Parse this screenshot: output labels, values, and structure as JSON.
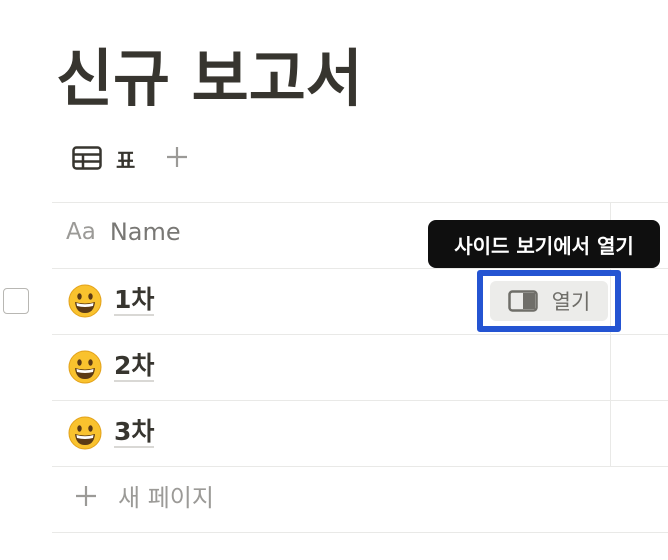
{
  "page": {
    "title": "신규 보고서"
  },
  "view_tabs": [
    {
      "icon": "table-icon",
      "label": "표"
    }
  ],
  "add_view": {
    "icon": "plus-icon"
  },
  "table": {
    "header": {
      "type_icon_text": "Aa",
      "name": "Name"
    },
    "rows": [
      {
        "emoji": "grinning-face-icon",
        "name": "1차"
      },
      {
        "emoji": "grinning-face-icon",
        "name": "2차"
      },
      {
        "emoji": "grinning-face-icon",
        "name": "3차"
      }
    ],
    "open_button": {
      "icon": "side-peek-icon",
      "label": "열기"
    },
    "new_page": {
      "icon": "plus-icon",
      "label": "새 페이지"
    }
  },
  "tooltip": {
    "text": "사이드 보기에서 열기"
  },
  "colors": {
    "highlight": "#2454d2",
    "tooltip_bg": "#0f0f0f",
    "text": "#37352f",
    "muted": "#9b9a97"
  }
}
